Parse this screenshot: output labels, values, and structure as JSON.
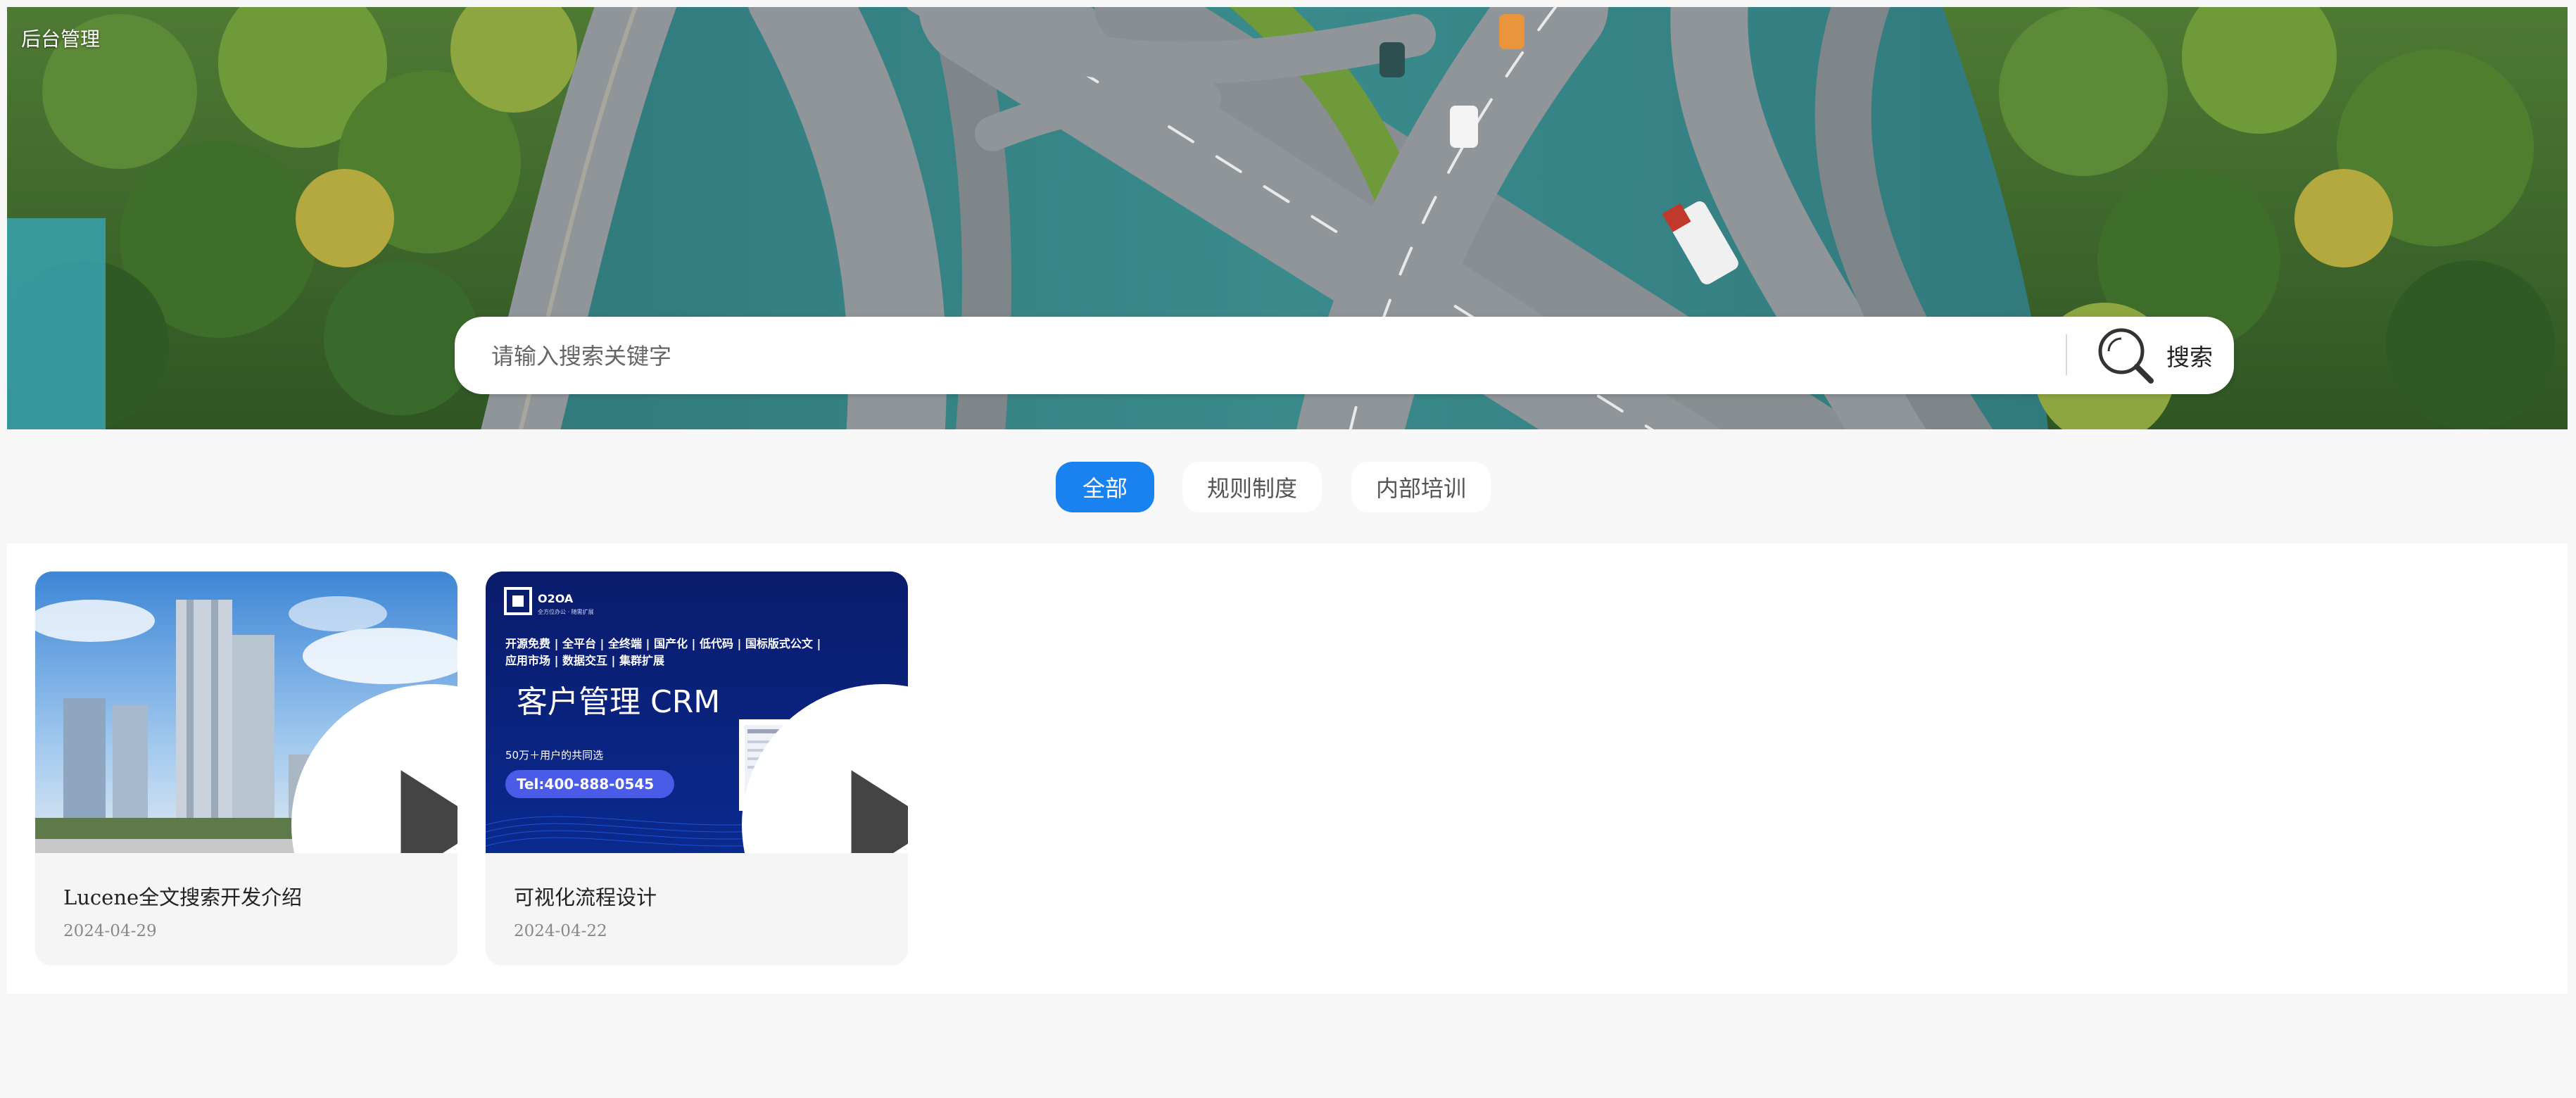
{
  "header": {
    "admin_link": "后台管理"
  },
  "search": {
    "placeholder": "请输入搜索关键字",
    "button_label": "搜索",
    "icon": "search-icon"
  },
  "tabs": [
    {
      "label": "全部",
      "active": true
    },
    {
      "label": "规则制度",
      "active": false
    },
    {
      "label": "内部培训",
      "active": false
    }
  ],
  "cards": [
    {
      "title": "Lucene全文搜索开发介绍",
      "date": "2024-04-29",
      "icon": "play-icon"
    },
    {
      "title": "可视化流程设计",
      "date": "2024-04-22",
      "icon": "play-icon",
      "thumb": {
        "brand": "O2OA",
        "brand_sub": "全方位办公 · 随需扩展",
        "features_line1": "开源免费 | 全平台 | 全终端 | 国产化 | 低代码 | 国标版式公文 |",
        "features_line2": "应用市场 | 数据交互 | 集群扩展",
        "headline": "客户管理 CRM",
        "users": "50万＋用户的共同选",
        "tel": "Tel:400-888-0545"
      }
    }
  ],
  "colors": {
    "accent": "#1a82f0",
    "page_bg": "#f7f7f7",
    "card_bg": "#f5f5f5"
  }
}
